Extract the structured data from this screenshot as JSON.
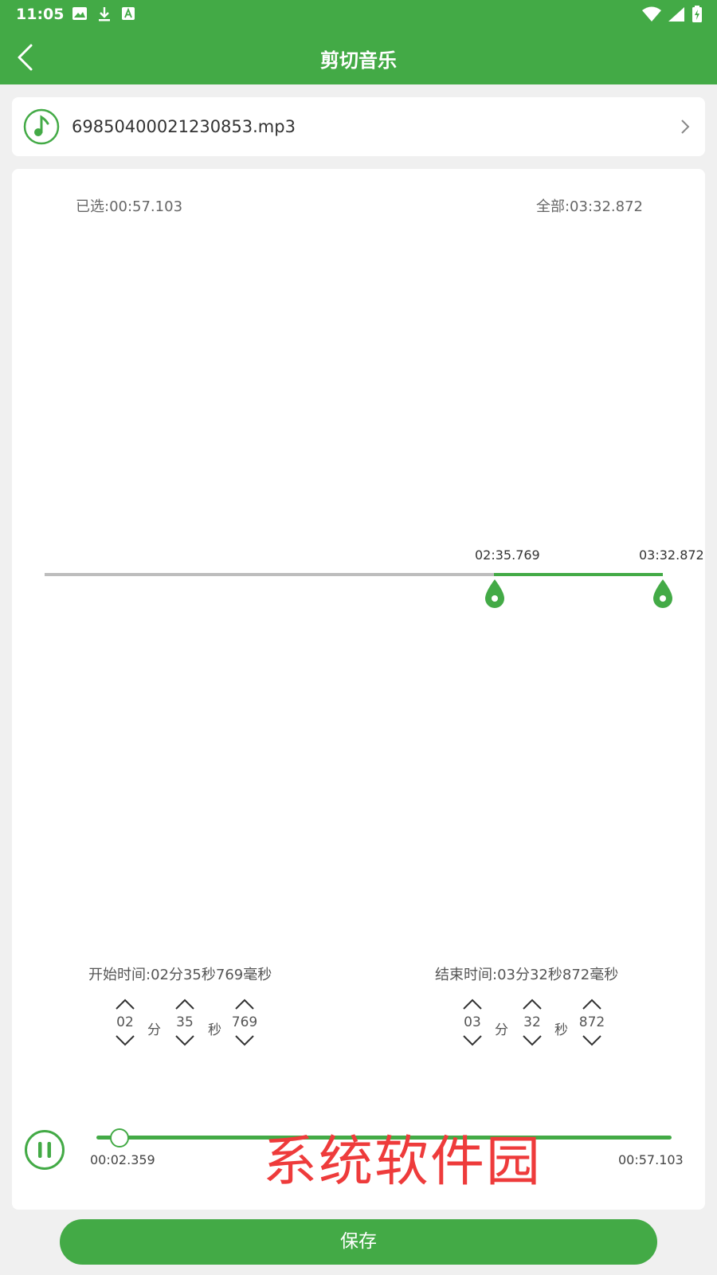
{
  "status_bar": {
    "time": "11:05",
    "icons": [
      "image-icon",
      "download-icon",
      "text-a-icon"
    ],
    "right_icons": [
      "wifi-icon",
      "signal-icon",
      "battery-icon"
    ]
  },
  "app_bar": {
    "title": "剪切音乐"
  },
  "file": {
    "name": "69850400021230853.mp3"
  },
  "selection": {
    "selected_text": "已选:00:57.103",
    "total_text": "全部:03:32.872"
  },
  "markers": {
    "start_label": "02:35.769",
    "end_label": "03:32.872"
  },
  "start_time": {
    "label": "开始时间:02分35秒769毫秒",
    "minutes": "02",
    "seconds": "35",
    "millis": "769",
    "unit_min": "分",
    "unit_sec": "秒"
  },
  "end_time": {
    "label": "结束时间:03分32秒872毫秒",
    "minutes": "03",
    "seconds": "32",
    "millis": "872",
    "unit_min": "分",
    "unit_sec": "秒"
  },
  "player": {
    "current": "00:02.359",
    "duration": "00:57.103",
    "progress_fraction": 0.041
  },
  "watermark": "系统软件园",
  "save_label": "保存",
  "colors": {
    "accent": "#43aa46",
    "watermark": "#ee3b3b"
  }
}
